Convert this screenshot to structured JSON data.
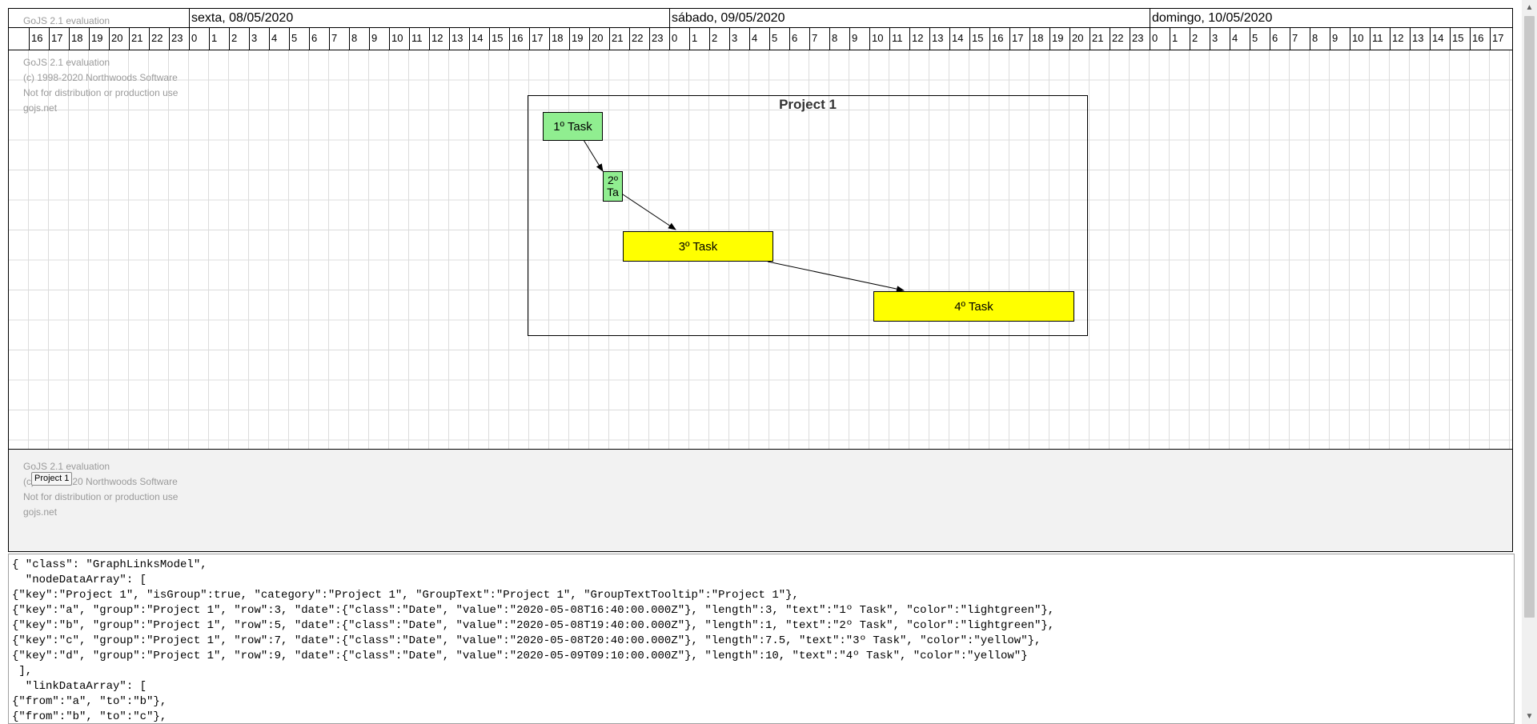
{
  "timeline": {
    "days": [
      {
        "label": "sexta, 08/05/2020"
      },
      {
        "label": "sábado, 09/05/2020"
      },
      {
        "label": "domingo, 10/05/2020"
      }
    ],
    "leading_hours": [
      "16",
      "17",
      "18",
      "19",
      "20",
      "21",
      "22",
      "23"
    ],
    "day_hours": [
      "0",
      "1",
      "2",
      "3",
      "4",
      "5",
      "6",
      "7",
      "8",
      "9",
      "10",
      "11",
      "12",
      "13",
      "14",
      "15",
      "16",
      "17",
      "18",
      "19",
      "20",
      "21",
      "22",
      "23"
    ],
    "last_day_hours": [
      "0",
      "1",
      "2",
      "3",
      "4",
      "5",
      "6",
      "7",
      "8",
      "9",
      "10",
      "11",
      "12",
      "13",
      "14",
      "15",
      "16",
      "17"
    ]
  },
  "watermark": {
    "line1": "GoJS 2.1 evaluation",
    "line2": "(c) 1998-2020 Northwoods Software",
    "line3": "Not for distribution or production use",
    "line4": "gojs.net"
  },
  "project": {
    "title": "Project 1",
    "tasks": [
      {
        "key": "a",
        "text": "1º Task",
        "color": "#90ee90"
      },
      {
        "key": "b",
        "text": "2º Ta",
        "color": "#90ee90"
      },
      {
        "key": "c",
        "text": "3º Task",
        "color": "#ffff00"
      },
      {
        "key": "d",
        "text": "4º Task",
        "color": "#ffff00"
      }
    ]
  },
  "overview": {
    "group_label": "Project 1"
  },
  "model_text": "{ \"class\": \"GraphLinksModel\",\n  \"nodeDataArray\": [\n{\"key\":\"Project 1\", \"isGroup\":true, \"category\":\"Project 1\", \"GroupText\":\"Project 1\", \"GroupTextTooltip\":\"Project 1\"},\n{\"key\":\"a\", \"group\":\"Project 1\", \"row\":3, \"date\":{\"class\":\"Date\", \"value\":\"2020-05-08T16:40:00.000Z\"}, \"length\":3, \"text\":\"1º Task\", \"color\":\"lightgreen\"},\n{\"key\":\"b\", \"group\":\"Project 1\", \"row\":5, \"date\":{\"class\":\"Date\", \"value\":\"2020-05-08T19:40:00.000Z\"}, \"length\":1, \"text\":\"2º Task\", \"color\":\"lightgreen\"},\n{\"key\":\"c\", \"group\":\"Project 1\", \"row\":7, \"date\":{\"class\":\"Date\", \"value\":\"2020-05-08T20:40:00.000Z\"}, \"length\":7.5, \"text\":\"3º Task\", \"color\":\"yellow\"},\n{\"key\":\"d\", \"group\":\"Project 1\", \"row\":9, \"date\":{\"class\":\"Date\", \"value\":\"2020-05-09T09:10:00.000Z\"}, \"length\":10, \"text\":\"4º Task\", \"color\":\"yellow\"}\n ],\n  \"linkDataArray\": [\n{\"from\":\"a\", \"to\":\"b\"},\n{\"from\":\"b\", \"to\":\"c\"},"
}
